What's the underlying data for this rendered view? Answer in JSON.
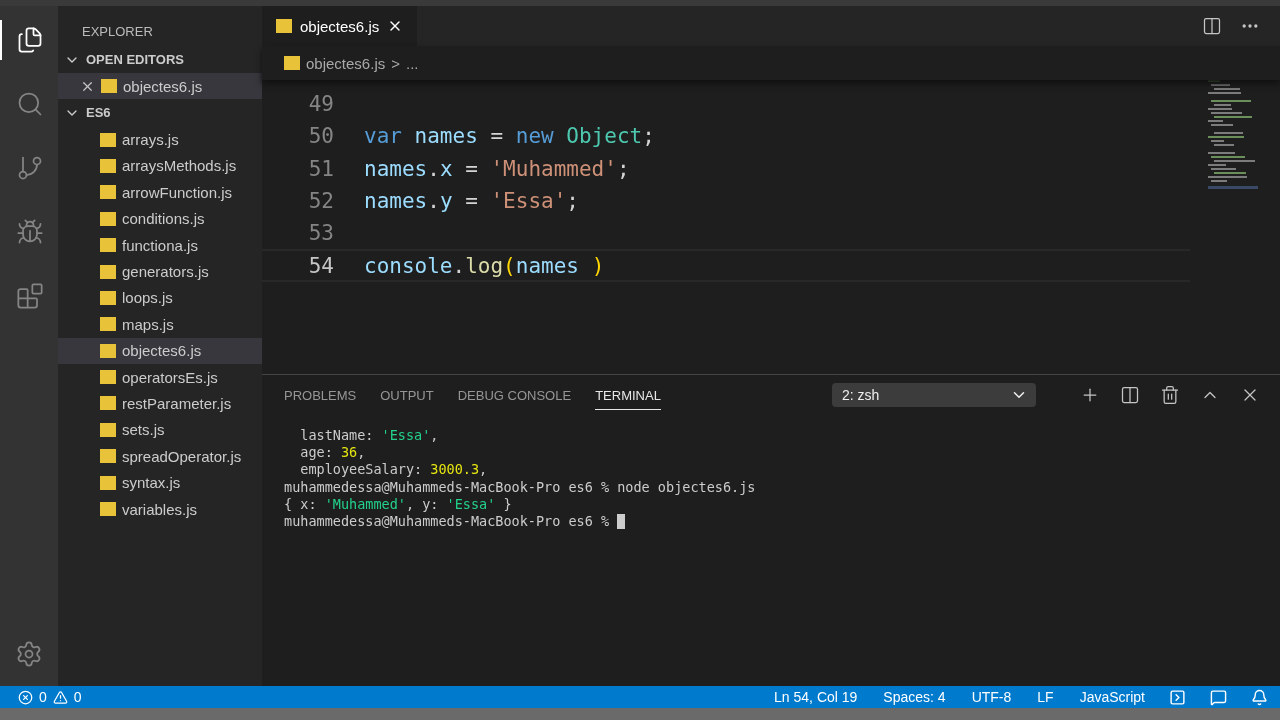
{
  "activity_bar": {
    "items": [
      {
        "kind": "files",
        "selected": true
      },
      {
        "kind": "search",
        "selected": false
      },
      {
        "kind": "scm",
        "selected": false
      },
      {
        "kind": "debug",
        "selected": false
      },
      {
        "kind": "extensions",
        "selected": false
      }
    ]
  },
  "sidebar": {
    "title": "EXPLORER",
    "sections": [
      {
        "title": "OPEN EDITORS",
        "expanded": true,
        "items": [
          {
            "name": "objectes6.js",
            "selected": true
          }
        ]
      },
      {
        "title": "ES6",
        "expanded": true,
        "items": [
          {
            "name": "arrays.js",
            "selected": false
          },
          {
            "name": "arraysMethods.js",
            "selected": false
          },
          {
            "name": "arrowFunction.js",
            "selected": false
          },
          {
            "name": "conditions.js",
            "selected": false
          },
          {
            "name": "functiona.js",
            "selected": false
          },
          {
            "name": "generators.js",
            "selected": false
          },
          {
            "name": "loops.js",
            "selected": false
          },
          {
            "name": "maps.js",
            "selected": false
          },
          {
            "name": "objectes6.js",
            "selected": true
          },
          {
            "name": "operatorsEs.js",
            "selected": false
          },
          {
            "name": "restParameter.js",
            "selected": false
          },
          {
            "name": "sets.js",
            "selected": false
          },
          {
            "name": "spreadOperator.js",
            "selected": false
          },
          {
            "name": "syntax.js",
            "selected": false
          },
          {
            "name": "variables.js",
            "selected": false
          }
        ]
      }
    ]
  },
  "tabs": [
    {
      "label": "objectes6.js",
      "selected": true
    }
  ],
  "breadcrumb": {
    "file": "objectes6.js",
    "separator": ">",
    "more": "..."
  },
  "editor": {
    "lines": [
      {
        "number": "49",
        "current": false
      },
      {
        "number": "50",
        "current": false,
        "tokens": [
          {
            "text": "var ",
            "kind": "keyword"
          },
          {
            "text": "names",
            "kind": "variable"
          },
          {
            "text": " = ",
            "kind": "plain"
          },
          {
            "text": "new ",
            "kind": "keyword"
          },
          {
            "text": "Object",
            "kind": "class"
          },
          {
            "text": ";",
            "kind": "plain"
          }
        ]
      },
      {
        "number": "51",
        "current": false,
        "tokens": [
          {
            "text": "names",
            "kind": "variable"
          },
          {
            "text": ".",
            "kind": "plain"
          },
          {
            "text": "x",
            "kind": "variable"
          },
          {
            "text": " = ",
            "kind": "plain"
          },
          {
            "text": "'Muhammed'",
            "kind": "string"
          },
          {
            "text": ";",
            "kind": "plain"
          }
        ]
      },
      {
        "number": "52",
        "current": false,
        "tokens": [
          {
            "text": "names",
            "kind": "variable"
          },
          {
            "text": ".",
            "kind": "plain"
          },
          {
            "text": "y",
            "kind": "variable"
          },
          {
            "text": " = ",
            "kind": "plain"
          },
          {
            "text": "'Essa'",
            "kind": "string"
          },
          {
            "text": ";",
            "kind": "plain"
          }
        ]
      },
      {
        "number": "53",
        "current": false
      },
      {
        "number": "54",
        "current": true,
        "tokens": [
          {
            "text": "console",
            "kind": "variable"
          },
          {
            "text": ".",
            "kind": "plain"
          },
          {
            "text": "log",
            "kind": "function"
          },
          {
            "text": "(",
            "kind": "bracket"
          },
          {
            "text": "names ",
            "kind": "variable"
          },
          {
            "text": ")",
            "kind": "bracket"
          }
        ]
      }
    ]
  },
  "panel": {
    "tabs": [
      {
        "label": "PROBLEMS",
        "selected": false
      },
      {
        "label": "OUTPUT",
        "selected": false
      },
      {
        "label": "DEBUG CONSOLE",
        "selected": false
      },
      {
        "label": "TERMINAL",
        "selected": true
      }
    ],
    "terminal_select": "2: zsh",
    "terminal": [
      {
        "tokens": [
          {
            "text": "  lastName: ",
            "kind": "plain"
          },
          {
            "text": "'Essa'",
            "kind": "string"
          },
          {
            "text": ",",
            "kind": "plain"
          }
        ]
      },
      {
        "tokens": [
          {
            "text": "  age: ",
            "kind": "plain"
          },
          {
            "text": "36",
            "kind": "number"
          },
          {
            "text": ",",
            "kind": "plain"
          }
        ]
      },
      {
        "tokens": [
          {
            "text": "  employeeSalary: ",
            "kind": "plain"
          },
          {
            "text": "3000.3",
            "kind": "number"
          },
          {
            "text": ",",
            "kind": "plain"
          }
        ]
      },
      {
        "tokens": [
          {
            "text": "muhammedessa@Muhammeds-MacBook-Pro es6 % node objectes6.js",
            "kind": "plain"
          }
        ]
      },
      {
        "tokens": [
          {
            "text": "{ x: ",
            "kind": "plain"
          },
          {
            "text": "'Muhammed'",
            "kind": "string"
          },
          {
            "text": ", y: ",
            "kind": "plain"
          },
          {
            "text": "'Essa'",
            "kind": "string"
          },
          {
            "text": " }",
            "kind": "plain"
          }
        ]
      },
      {
        "tokens": [
          {
            "text": "muhammedessa@Muhammeds-MacBook-Pro es6 % ",
            "kind": "plain"
          }
        ],
        "cursor": true
      }
    ]
  },
  "status_bar": {
    "errors": "0",
    "warnings": "0",
    "position": "Ln 54, Col 19",
    "spaces": "Spaces: 4",
    "encoding": "UTF-8",
    "eol": "LF",
    "language": "JavaScript"
  }
}
